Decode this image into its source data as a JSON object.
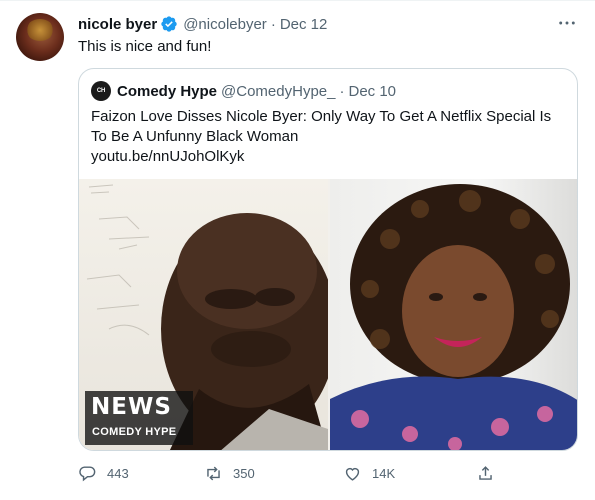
{
  "tweet": {
    "name": "nicole byer",
    "handle": "@nicolebyer",
    "dot": "·",
    "date": "Dec 12",
    "text": "This is nice and fun!"
  },
  "quote": {
    "name": "Comedy Hype",
    "handle": "@ComedyHype_",
    "dot": "·",
    "date": "Dec 10",
    "avatar_text": "CH",
    "text": "Faizon Love Disses Nicole Byer: Only Way To Get A Netflix Special Is To Be A Unfunny Black Woman",
    "link": "youtu.be/nnUJohOlKyk",
    "badge_title": "NEWS",
    "badge_subtitle": "COMEDY HYPE"
  },
  "actions": {
    "replies": "443",
    "retweets": "350",
    "likes": "14K"
  },
  "colors": {
    "verified": "#1d9bf0",
    "secondary_text": "#536471",
    "border": "#cfd9de"
  },
  "icons": [
    "verified-icon",
    "more-icon",
    "reply-icon",
    "retweet-icon",
    "like-icon",
    "share-icon"
  ]
}
